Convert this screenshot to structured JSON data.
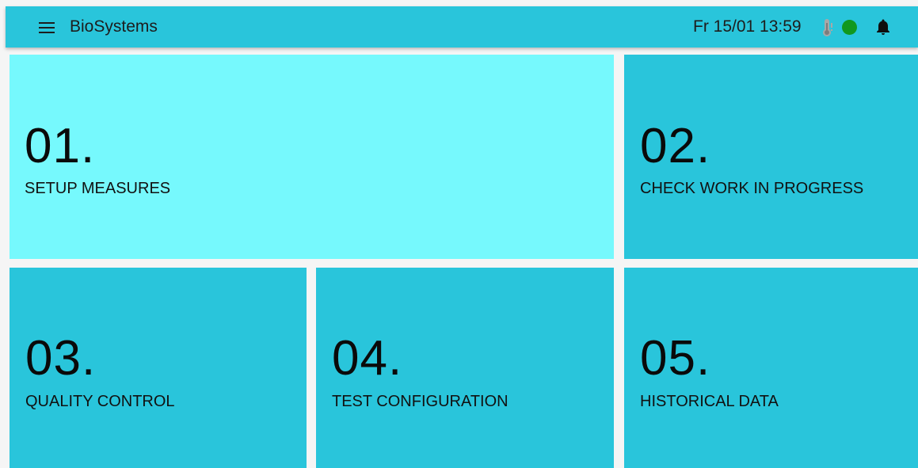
{
  "header": {
    "title": "BioSystems",
    "datetime": "Fr 15/01 13:59",
    "icons": [
      "menu-icon",
      "thermometer-icon",
      "status-indicator",
      "bell-icon"
    ],
    "status_color": "#11981e"
  },
  "tiles": [
    {
      "number": "01.",
      "label": "SETUP MEASURES",
      "active": true
    },
    {
      "number": "02.",
      "label": "CHECK WORK IN PROGRESS",
      "active": false
    },
    {
      "number": "03.",
      "label": "QUALITY CONTROL",
      "active": false
    },
    {
      "number": "04.",
      "label": "TEST CONFIGURATION",
      "active": false
    },
    {
      "number": "05.",
      "label": "HISTORICAL DATA",
      "active": false
    }
  ],
  "colors": {
    "appbar": "#29c5db",
    "tile": "#29c5db",
    "tile_active": "#76f9fd"
  }
}
